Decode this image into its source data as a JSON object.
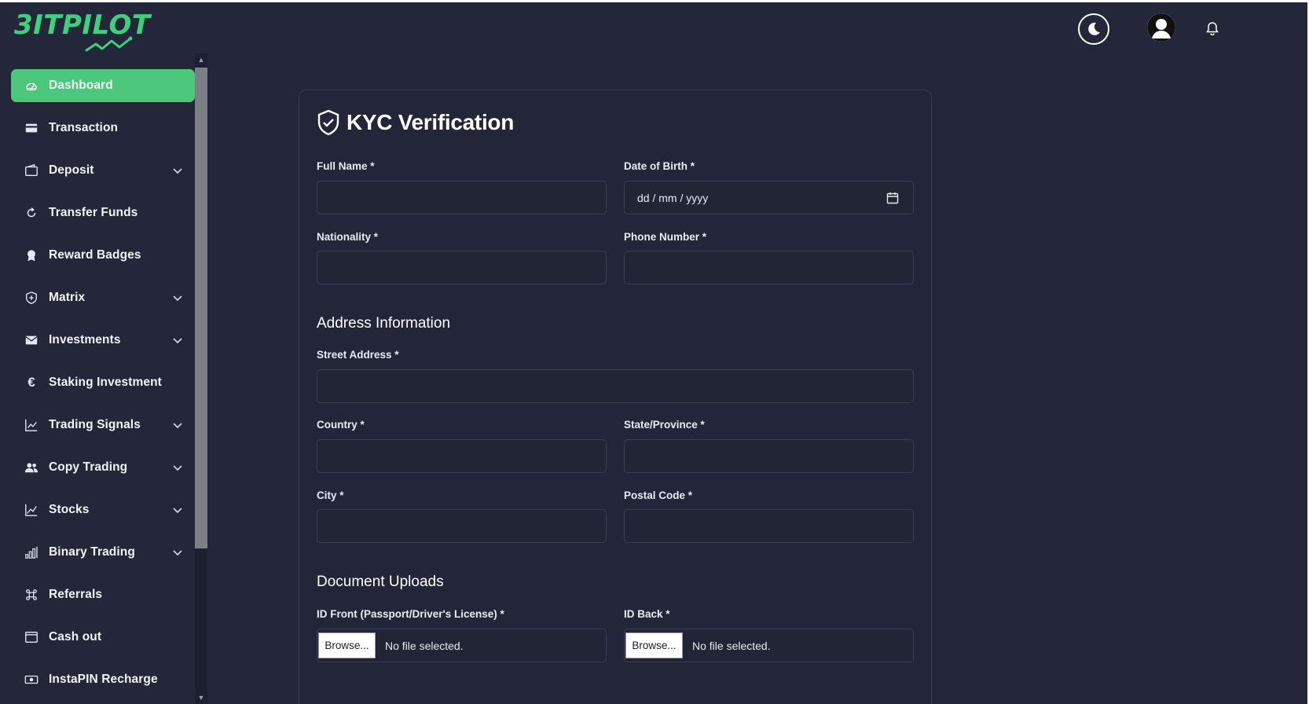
{
  "brand": {
    "logo_text": "3ITPILOT",
    "accent": "#3ed17c"
  },
  "sidebar": {
    "items": [
      {
        "label": "Dashboard",
        "icon": "gauge-icon",
        "active": true,
        "has_submenu": false
      },
      {
        "label": "Transaction",
        "icon": "credit-card-icon",
        "active": false,
        "has_submenu": false
      },
      {
        "label": "Deposit",
        "icon": "wallet-icon",
        "active": false,
        "has_submenu": true
      },
      {
        "label": "Transfer Funds",
        "icon": "refresh-icon",
        "active": false,
        "has_submenu": false
      },
      {
        "label": "Reward Badges",
        "icon": "award-icon",
        "active": false,
        "has_submenu": false
      },
      {
        "label": "Matrix",
        "icon": "shield-plus-icon",
        "active": false,
        "has_submenu": true
      },
      {
        "label": "Investments",
        "icon": "envelope-icon",
        "active": false,
        "has_submenu": true
      },
      {
        "label": "Staking Investment",
        "icon": "euro-icon",
        "active": false,
        "has_submenu": false
      },
      {
        "label": "Trading Signals",
        "icon": "chart-line-icon",
        "active": false,
        "has_submenu": true
      },
      {
        "label": "Copy Trading",
        "icon": "users-icon",
        "active": false,
        "has_submenu": true
      },
      {
        "label": "Stocks",
        "icon": "graph-icon",
        "active": false,
        "has_submenu": true
      },
      {
        "label": "Binary Trading",
        "icon": "bar-chart-icon",
        "active": false,
        "has_submenu": true
      },
      {
        "label": "Referrals",
        "icon": "command-icon",
        "active": false,
        "has_submenu": false
      },
      {
        "label": "Cash out",
        "icon": "window-icon",
        "active": false,
        "has_submenu": false
      },
      {
        "label": "InstaPIN Recharge",
        "icon": "cash-icon",
        "active": false,
        "has_submenu": false
      }
    ]
  },
  "header": {
    "theme_toggle_icon": "moon-icon",
    "avatar_icon": "user-avatar-icon",
    "notification_icon": "bell-icon"
  },
  "kyc": {
    "title": "KYC Verification",
    "title_icon": "shield-check-icon",
    "fields": {
      "full_name": {
        "label": "Full Name *",
        "value": ""
      },
      "dob": {
        "label": "Date of Birth *",
        "value": "dd / mm / yyyy"
      },
      "nationality": {
        "label": "Nationality *",
        "value": ""
      },
      "phone": {
        "label": "Phone Number *",
        "value": ""
      },
      "street": {
        "label": "Street Address *",
        "value": ""
      },
      "country": {
        "label": "Country *",
        "value": ""
      },
      "state": {
        "label": "State/Province *",
        "value": ""
      },
      "city": {
        "label": "City *",
        "value": ""
      },
      "postal": {
        "label": "Postal Code *",
        "value": ""
      }
    },
    "address_section_title": "Address Information",
    "documents_section_title": "Document Uploads",
    "uploads": {
      "id_front": {
        "label": "ID Front (Passport/Driver's License) *",
        "button": "Browse...",
        "status": "No file selected."
      },
      "id_back": {
        "label": "ID Back *",
        "button": "Browse...",
        "status": "No file selected."
      }
    }
  }
}
